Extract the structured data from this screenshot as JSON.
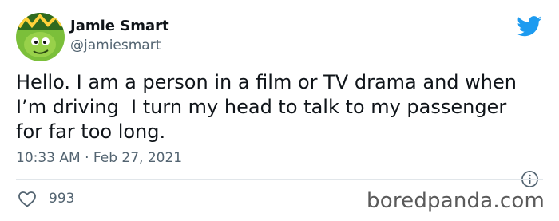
{
  "tweet": {
    "author_name": "Jamie Smart",
    "author_handle": "@jamiesmart",
    "text": "Hello. I am a person in a film or TV drama and when\nI’m driving  I turn my head to talk to my passenger\nfor far too long.",
    "timestamp": "10:33 AM · Feb 27, 2021",
    "like_count": "993"
  },
  "icons": {
    "brand": "twitter-bird-icon",
    "info": "info-icon",
    "like": "heart-icon",
    "avatar": "avatar"
  },
  "colors": {
    "twitter_blue": "#1d9bf0",
    "secondary_text": "#536471",
    "primary_text": "#0f1419"
  },
  "watermark": "boredpanda.com"
}
